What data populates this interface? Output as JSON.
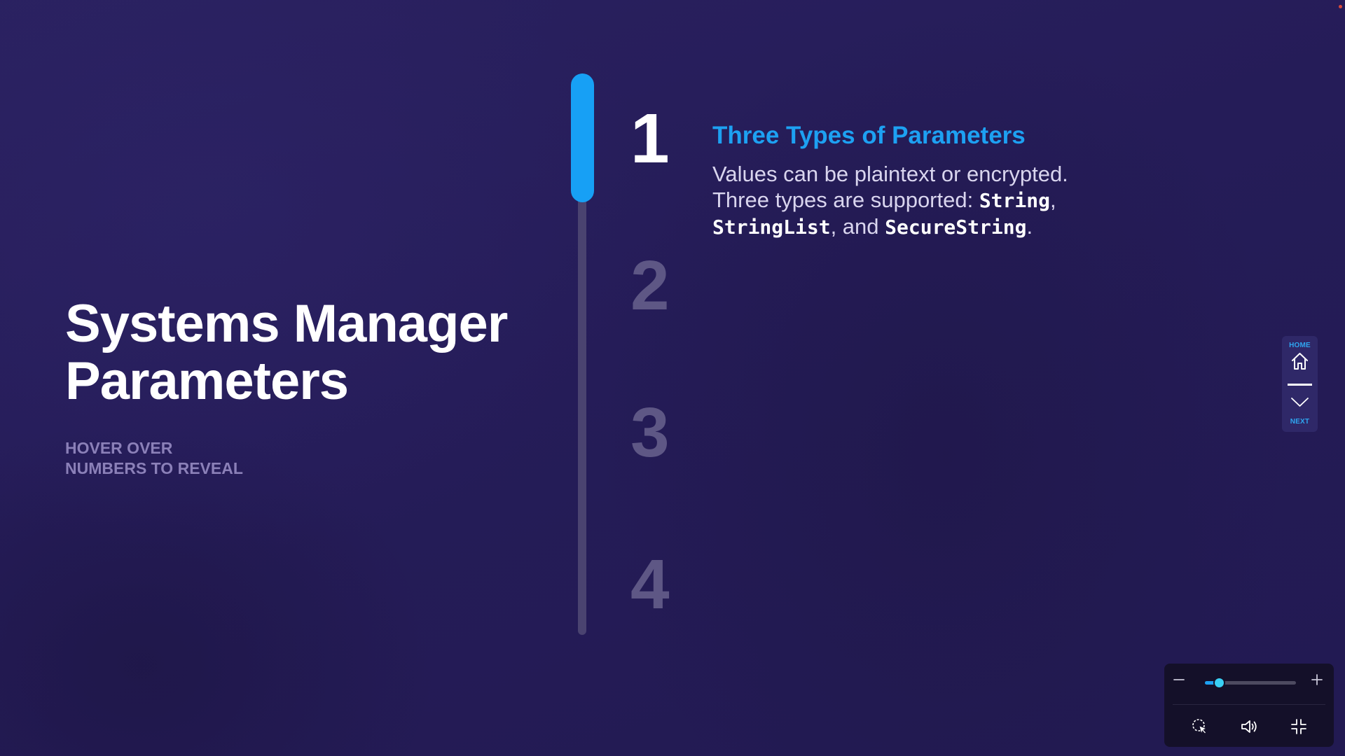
{
  "hero": {
    "title_line1": "Systems Manager",
    "title_line2": "Parameters",
    "hint_line1": "HOVER OVER",
    "hint_line2": "NUMBERS TO REVEAL"
  },
  "steps": [
    {
      "number": "1",
      "active": true
    },
    {
      "number": "2",
      "active": false
    },
    {
      "number": "3",
      "active": false
    },
    {
      "number": "4",
      "active": false
    }
  ],
  "progress": {
    "current_step": 1,
    "total_steps": 4
  },
  "reveal": {
    "title": "Three Types of Parameters",
    "text_1": "Values can be plaintext or encrypted.",
    "text_2": "Three types are supported: ",
    "type_1": "String",
    "sep_1": ",",
    "type_2": "StringList",
    "sep_2": ", and ",
    "type_3": "SecureString",
    "end": "."
  },
  "side_nav": {
    "home_label": "HOME",
    "next_label": "NEXT",
    "home_icon": "home-icon",
    "next_icon": "chevron-down-icon"
  },
  "player_controls": {
    "zoom_out_icon": "minus-icon",
    "zoom_in_icon": "plus-icon",
    "zoom_level": 0.15,
    "cursor_icon": "cursor-highlight-icon",
    "volume_icon": "volume-icon",
    "fullscreen_icon": "exit-fullscreen-icon"
  },
  "colors": {
    "background": "#241b55",
    "accent": "#1da1f2",
    "inactive_number": "#5e5785",
    "hint_text": "#8b80b8"
  }
}
